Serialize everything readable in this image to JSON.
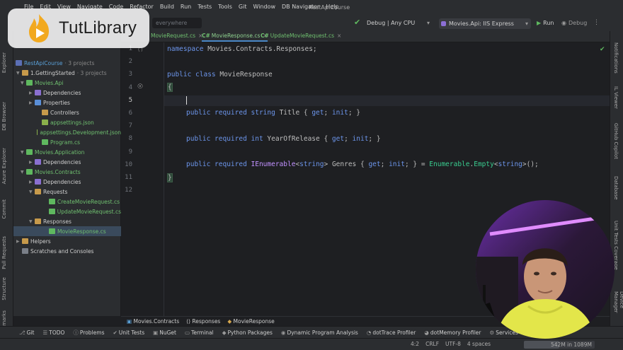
{
  "menubar": {
    "items": [
      "File",
      "Edit",
      "View",
      "Navigate",
      "Code",
      "Refactor",
      "Build",
      "Run",
      "Tests",
      "Tools",
      "Git",
      "Window",
      "DB Navigator",
      "Help"
    ],
    "project_title": "RestApiCourse"
  },
  "toolbar": {
    "search_placeholder": "everywhere",
    "config": "Debug | Any CPU",
    "run_config": "Movies.Api: IIS Express",
    "run_label": "Run",
    "debug_label": "Debug"
  },
  "logo": {
    "text": "TutLibrary"
  },
  "left_tabs": [
    "Explorer",
    "DB Browser",
    "Azure Explorer",
    "Commit",
    "Pull Requests",
    "Structure",
    "Bookmarks"
  ],
  "right_tabs": [
    "Notifications",
    "IL Viewer",
    "GitHub Copilot",
    "Database",
    "Unit Tests Coverage",
    "Device Manager"
  ],
  "project_tree": {
    "solution": "RestApiCourse",
    "solution_meta": "· 3 projects",
    "folder": "1.GettingStarted",
    "folder_meta": "· 3 projects",
    "nodes": [
      {
        "label": "Movies.Api"
      },
      {
        "label": "Dependencies"
      },
      {
        "label": "Properties"
      },
      {
        "label": "Controllers"
      },
      {
        "label": "appsettings.json"
      },
      {
        "label": "appsettings.Development.json"
      },
      {
        "label": "Program.cs"
      },
      {
        "label": "Movies.Application"
      },
      {
        "label": "Dependencies"
      },
      {
        "label": "Movies.Contracts"
      },
      {
        "label": "Dependencies"
      },
      {
        "label": "Requests"
      },
      {
        "label": "CreateMovieRequest.cs"
      },
      {
        "label": "UpdateMovieRequest.cs"
      },
      {
        "label": "Responses"
      },
      {
        "label": "MovieResponse.cs"
      },
      {
        "label": "Helpers"
      },
      {
        "label": "Scratches and Consoles"
      }
    ]
  },
  "editor_tabs": [
    {
      "label": "MovieRequest.cs"
    },
    {
      "label": "MovieResponse.cs"
    },
    {
      "label": "UpdateMovieRequest.cs"
    }
  ],
  "code": {
    "line_numbers": [
      "1",
      "2",
      "3",
      "4",
      "5",
      "6",
      "7",
      "8",
      "9",
      "10",
      "11",
      "12"
    ],
    "l1_kw": "namespace",
    "l1_rest": " Movies.Contracts.Responses;",
    "l3_kw": "public class",
    "l3_rest": " MovieResponse",
    "l4": "{",
    "l6_kw": "public required string",
    "l6_rest": " Title { ",
    "l6_get": "get",
    "l6_mid": "; ",
    "l6_init": "init",
    "l6_end": "; }",
    "l8_kw": "public required int",
    "l8_rest": " YearOfRelease { ",
    "l8_get": "get",
    "l8_mid": "; ",
    "l8_init": "init",
    "l8_end": "; }",
    "l10_kw": "public required",
    "l10_type": " IEnumerable",
    "l10_gen1": "<",
    "l10_str1": "string",
    "l10_gen2": ">",
    "l10_name": " Genres { ",
    "l10_get": "get",
    "l10_mid": "; ",
    "l10_init": "init",
    "l10_eq": "; } = ",
    "l10_en": "Enumerable",
    "l10_dot": ".",
    "l10_empty": "Empty",
    "l10_lt": "<",
    "l10_str2": "string",
    "l10_tail": ">();",
    "l11": "}"
  },
  "breadcrumb": [
    "Movies.Contracts",
    "Responses",
    "MovieResponse"
  ],
  "bottom_tools": [
    "Git",
    "TODO",
    "Problems",
    "Unit Tests",
    "NuGet",
    "Terminal",
    "Python Packages",
    "Dynamic Program Analysis",
    "dotTrace Profiler",
    "dotMemory Profiler",
    "Services"
  ],
  "status": {
    "position": "4:2",
    "line_ending": "CRLF",
    "encoding": "UTF-8",
    "indent": "4 spaces",
    "memory": "542M in 1089M",
    "memory_fraction": 0.5
  },
  "colors": {
    "keyword": "#6c95eb",
    "type": "#c191ff",
    "accessor": "#39cc8f",
    "green_project": "#6fbf6f"
  }
}
